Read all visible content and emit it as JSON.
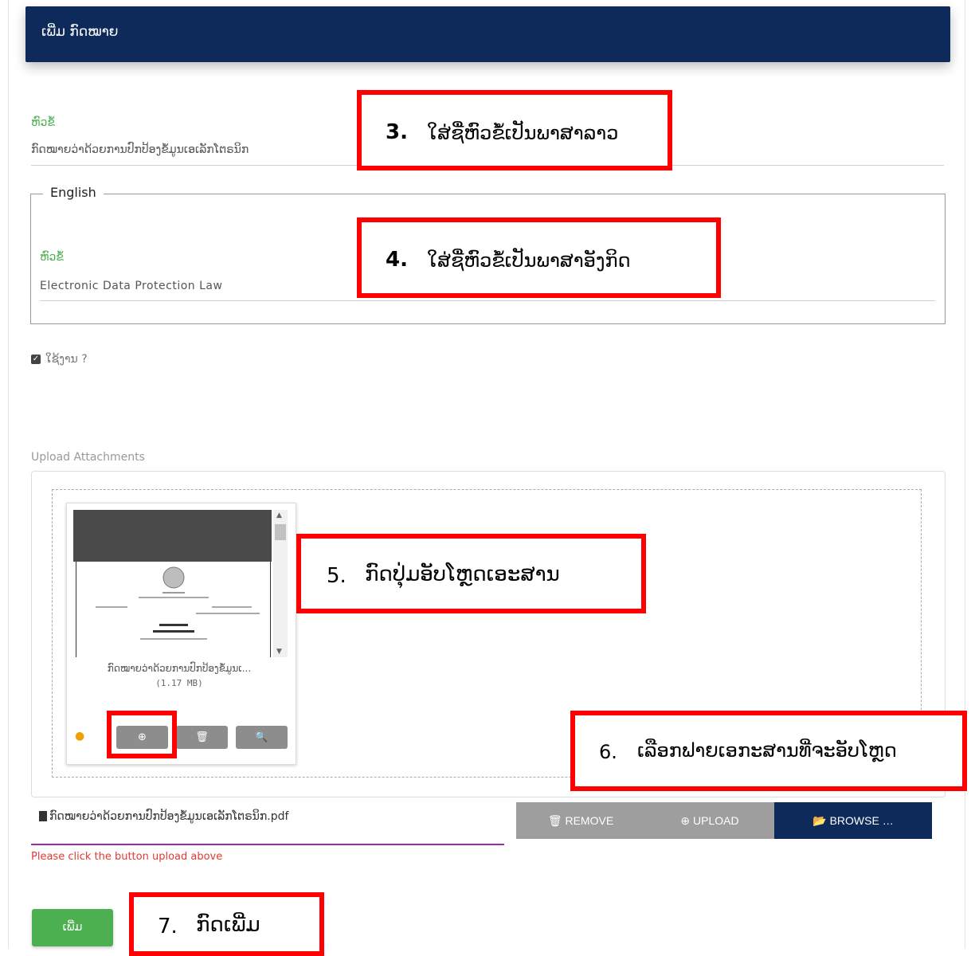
{
  "header": {
    "title": "ເພີ່ມ ກົດໝາຍ"
  },
  "title_field": {
    "label": "ຫົວຂໍ້",
    "value": "ກົດໝາຍວ່າດ້ວຍການປົກປ້ອງຂໍ້ມູນເອເລັກໂຕຣນິກ"
  },
  "english": {
    "legend": "English",
    "label": "ຫົວຂໍ້",
    "value": "Electronic Data Protection Law"
  },
  "active": {
    "checked": true,
    "label": "ໃຊ້ງານ ?"
  },
  "attachments": {
    "label": "Upload Attachments",
    "thumb_caption": "ກົດໝາຍວ່າດ້ວຍການປົກປ້ອງຂໍ້ມູນເ...",
    "thumb_size": "(1.17 MB)",
    "filename": "ກົດໝາຍວ່າດ້ວຍການປົກປ້ອງຂໍ້ມູນເອເລັກໂຕຣນິກ.pdf",
    "hint": "Please click the button upload above",
    "remove_label": "REMOVE",
    "upload_label": "UPLOAD",
    "browse_label": "BROWSE …"
  },
  "submit": {
    "label": "ເພີ່ມ"
  },
  "annotations": [
    {
      "num": "3.",
      "text": "ໃສ່ຊື່ຫົວຂໍ້ເປັນພາສາລາວ"
    },
    {
      "num": "4.",
      "text": "ໃສ່ຊື່ຫົວຂໍ້ເປັນພາສາອັງກິດ"
    },
    {
      "num": "5.",
      "text": "ກົດປຸ່ມອັບໂຫຼດເອະສານ"
    },
    {
      "num": "6.",
      "text": "ເລືອກຟາຍເອກະສານທີ່ຈະອັບໂຫຼດ"
    },
    {
      "num": "7.",
      "text": "ກົດເພີ່ມ"
    }
  ],
  "colors": {
    "header_bg": "#0e2a5a",
    "label_green": "#4caf50",
    "annotation_red": "#ff0000",
    "browse_bg": "#0e2a5a",
    "button_gray": "#9e9e9e",
    "submit_green": "#4caf50",
    "error_red": "#e53935",
    "underline_purple": "#9c27b0"
  }
}
